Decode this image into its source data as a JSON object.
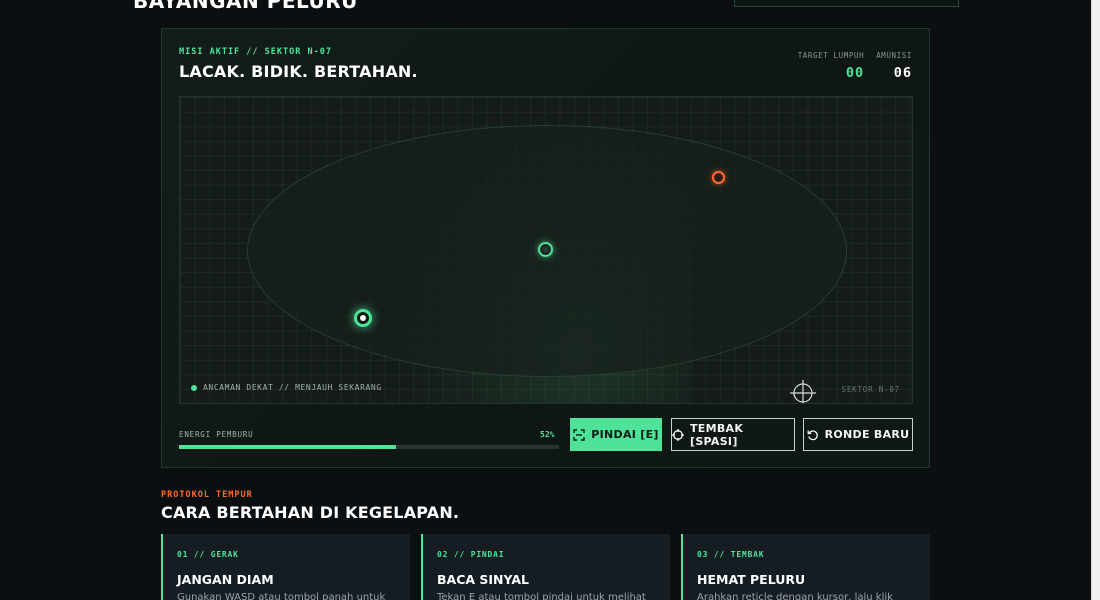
{
  "site": {
    "title": "BAYANGAN PELURU"
  },
  "mission": {
    "kicker": "MISI AKTIF // SEKTOR N-07",
    "headline": "LACAK. BIDIK. BERTAHAN.",
    "stats": [
      {
        "label": "TARGET LUMPUH",
        "value": "00",
        "color": "#4fe39a"
      },
      {
        "label": "AMUNISI",
        "value": "06",
        "color": "#ffffff"
      }
    ]
  },
  "arena": {
    "status_text": "ANCAMAN DEKAT // MENJAUH SEKARANG",
    "sector_tag": "SEKTOR N-07",
    "icons": [
      "status-dot-icon",
      "crosshair-icon"
    ]
  },
  "energy": {
    "label": "ENERGI PEMBURU",
    "percent_text": "52%",
    "level": 0.57
  },
  "controls": {
    "scan_label": "PINDAI [E]",
    "fire_label": "TEMBAK [SPASI]",
    "reset_label": "RONDE BARU"
  },
  "protocol": {
    "kicker": "PROTOKOL TEMPUR",
    "title": "CARA BERTAHAN DI KEGELAPAN.",
    "cards": [
      {
        "tag": "01 // GERAK",
        "title": "JANGAN DIAM",
        "body": "Gunakan WASD atau tombol panah untuk"
      },
      {
        "tag": "02 // PINDAI",
        "title": "BACA SINYAL",
        "body": "Tekan E atau tombol pindai untuk melihat"
      },
      {
        "tag": "03 // TEMBAK",
        "title": "HEMAT PELURU",
        "body": "Arahkan reticle dengan kursor, lalu klik"
      }
    ]
  },
  "colors": {
    "accent": "#4fe39a",
    "threat": "#ff6a2c",
    "background": "#0b0f12"
  }
}
